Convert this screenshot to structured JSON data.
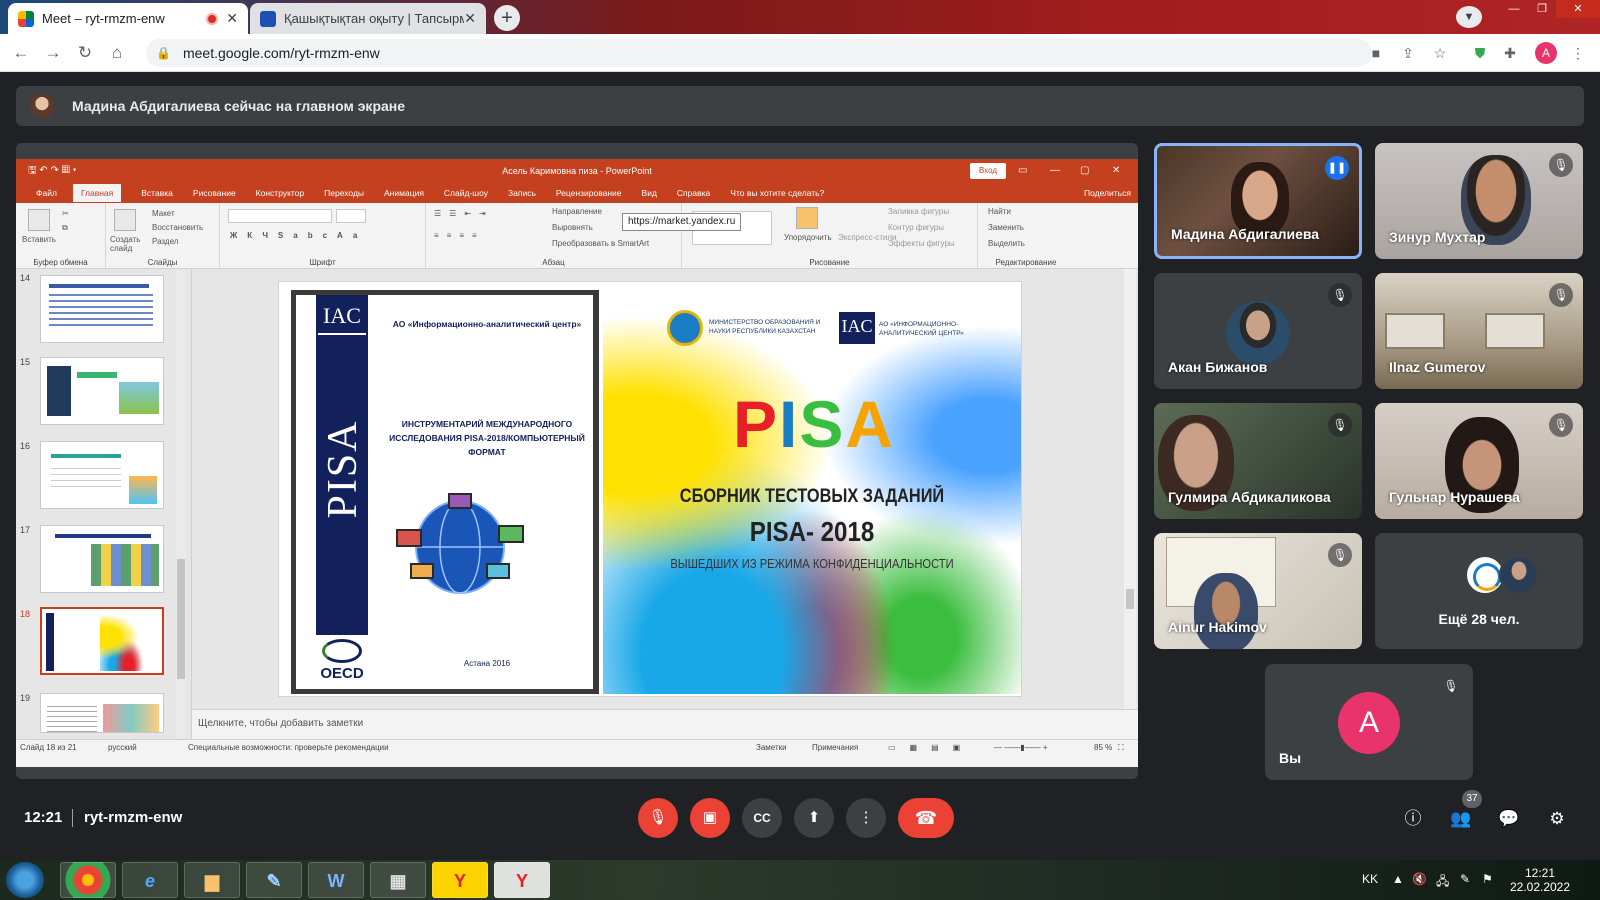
{
  "browser": {
    "tabs": [
      {
        "title": "Meet – ryt-rmzm-enw",
        "active": true
      },
      {
        "title": "Қашықтықтан оқыту | Тапсырма",
        "active": false
      }
    ],
    "url": "meet.google.com/ryt-rmzm-enw",
    "profile_initial": "A"
  },
  "meet": {
    "presenter_banner": "Мадина Абдигалиева сейчас на главном экране",
    "time": "12:21",
    "code": "ryt-rmzm-enw",
    "participant_count": "37",
    "participants": [
      {
        "name": "Мадина Абдигалиева",
        "speaking": true
      },
      {
        "name": "Зинур Мухтар"
      },
      {
        "name": "Акан Бижанов"
      },
      {
        "name": "Ilnaz Gumerov"
      },
      {
        "name": "Гулмира Абдикаликова"
      },
      {
        "name": "Гульнар Нурашева"
      },
      {
        "name": "Ainur Hakimov"
      }
    ],
    "more_label": "Ещё 28 чел.",
    "self_label": "Вы",
    "self_initial": "A"
  },
  "ppt": {
    "window_title": "Асель Каримовна пиза - PowerPoint",
    "login": "Вход",
    "menu": [
      "Файл",
      "Главная",
      "Вставка",
      "Рисование",
      "Конструктор",
      "Переходы",
      "Анимация",
      "Слайд-шоу",
      "Запись",
      "Рецензирование",
      "Вид",
      "Справка",
      "Что вы хотите сделать?"
    ],
    "share": "Поделиться",
    "tooltip": "https://market.yandex.ru",
    "ribbon": {
      "groups": [
        "Буфер обмена",
        "Слайды",
        "Шрифт",
        "Абзац",
        "Рисование",
        "Редактирование"
      ],
      "paste": "Вставить",
      "create_slide": "Создать слайд",
      "layout": "Макет",
      "restore": "Восстановить",
      "section": "Раздел",
      "direction": "Направление",
      "align": "Выровнять",
      "smartart": "Преобразовать в SmartArt",
      "arrange": "Упорядочить",
      "express": "Экспресс-стили",
      "fill": "Заливка фигуры",
      "outline": "Контур фигуры",
      "effects": "Эффекты фигуры",
      "find": "Найти",
      "replace": "Заменить",
      "select": "Выделить"
    },
    "thumb_numbers": [
      "14",
      "15",
      "16",
      "17",
      "18",
      "19"
    ],
    "selected_slide": "18",
    "notes_placeholder": "Щелкните, чтобы добавить заметки",
    "status": {
      "slide": "Слайд 18 из 21",
      "language": "русский",
      "accessibility": "Специальные возможности: проверьте рекомендации",
      "notes": "Заметки",
      "comments": "Примечания",
      "zoom": "85 %"
    },
    "slide": {
      "cover_iac": "IAC",
      "cover_pisa": "PISA",
      "cover_org": "АО «Информационно-аналитический центр»",
      "cover_instr": "ИНСТРУМЕНТАРИЙ МЕЖДУНАРОДНОГО ИССЛЕДОВАНИЯ PISA-2018/КОМПЬЮТЕРНЫЙ ФОРМАТ",
      "cover_oecd": "OECD",
      "cover_city": "Астана 2016",
      "ministry": "МИНИСТЕРСТВО ОБРАЗОВАНИЯ И НАУКИ РЕСПУБЛИКИ КАЗАХСТАН",
      "iac_small": "IAC",
      "iac_small_text": "АО «ИНФОРМАЦИОННО-АНАЛИТИЧЕСКИЙ ЦЕНТР»",
      "pisa_letters": [
        "P",
        "I",
        "S",
        "A"
      ],
      "sbornik": "СБОРНИК ТЕСТОВЫХ ЗАДАНИЙ",
      "pisa2018": "PISA- 2018",
      "vysh": "ВЫШЕДШИХ ИЗ РЕЖИМА КОНФИДЕНЦИАЛЬНОСТИ"
    }
  },
  "taskbar": {
    "lang": "KK",
    "time": "12:21",
    "date": "22.02.2022"
  },
  "colors": {
    "meet_bg": "#202124",
    "tile_bg": "#3c4043",
    "ppt_accent": "#c5401f",
    "danger": "#ea4335",
    "avatar_pink": "#e8336c"
  }
}
